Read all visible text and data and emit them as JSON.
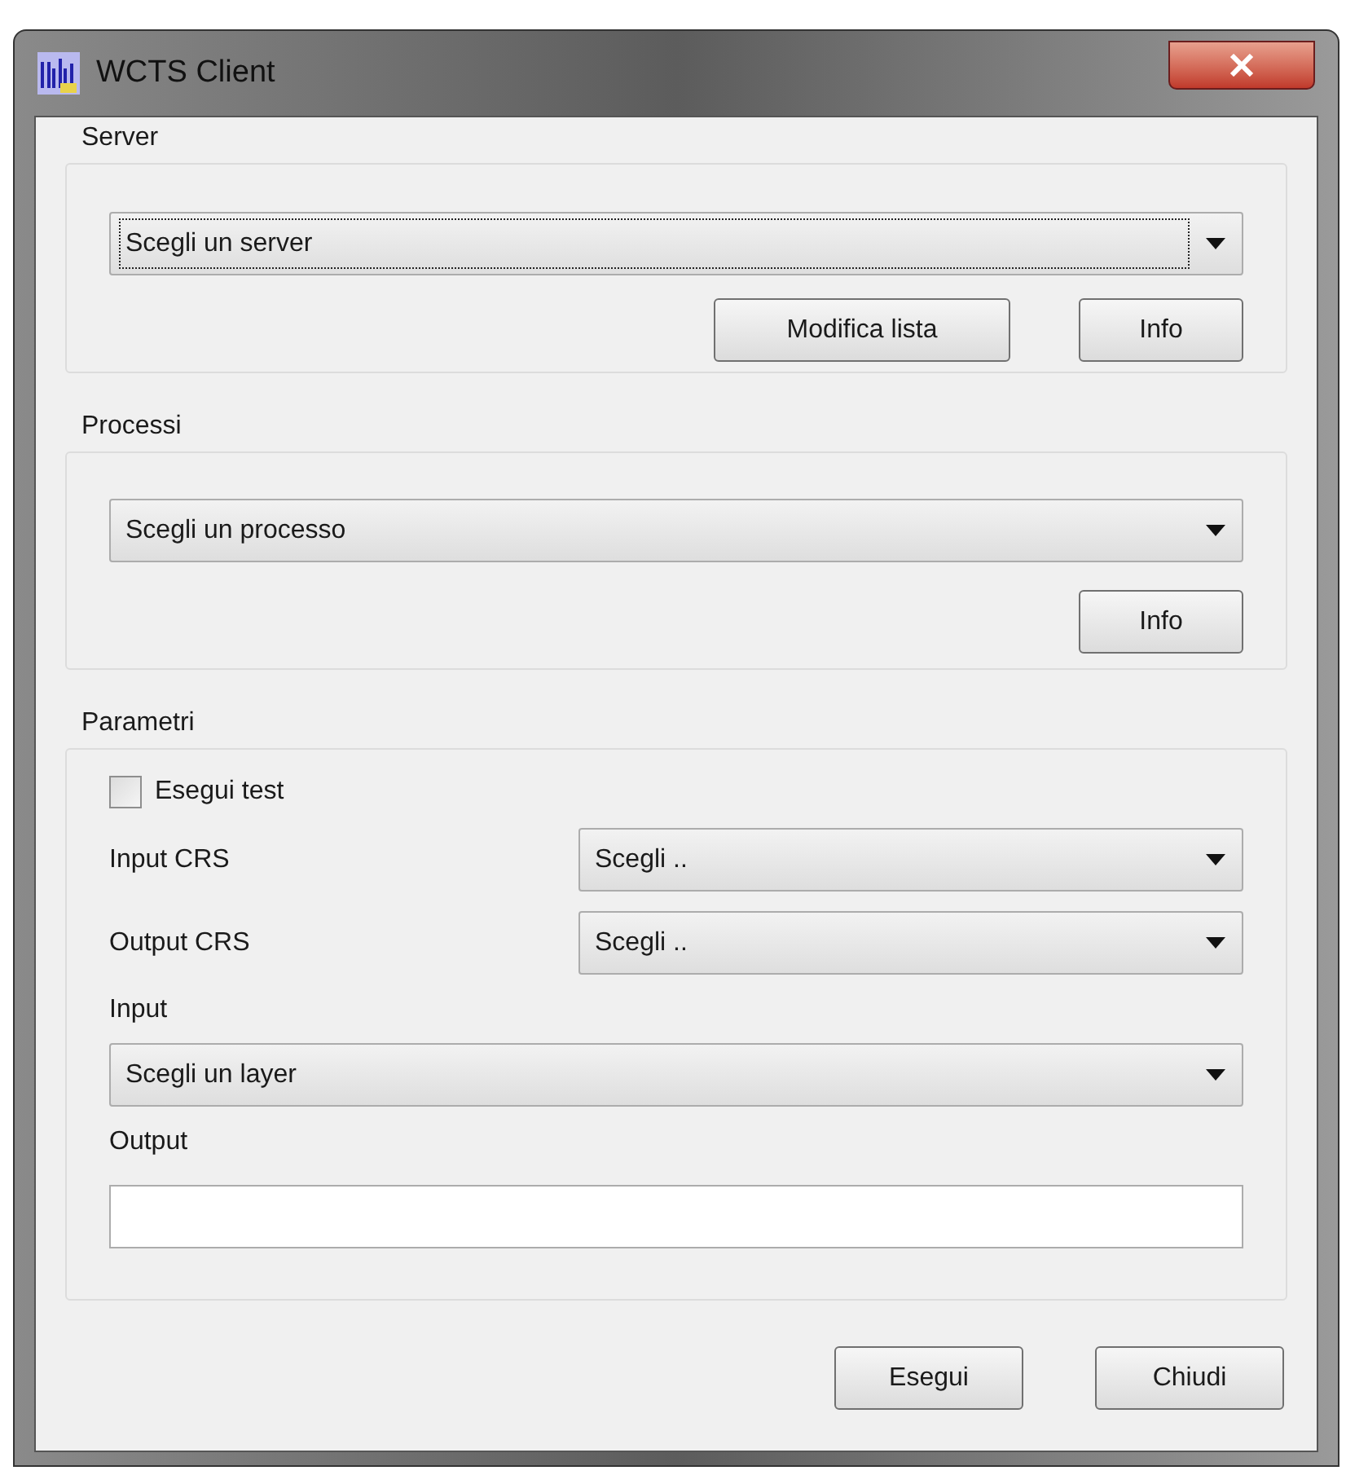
{
  "window": {
    "title": "WCTS Client"
  },
  "server": {
    "title": "Server",
    "combo": {
      "value": "Scegli un server",
      "focused": true
    },
    "buttons": [
      "Modifica lista",
      "Info"
    ]
  },
  "processi": {
    "title": "Processi",
    "combo": {
      "value": "Scegli un processo",
      "focused": false
    },
    "buttons": [
      "Info"
    ]
  },
  "parametri": {
    "title": "Parametri",
    "test": {
      "label": "Esegui test",
      "checked": false
    },
    "input_crs": {
      "label": "Input CRS",
      "value": "Scegli .."
    },
    "output_crs": {
      "label": "Output CRS",
      "value": "Scegli .."
    },
    "input": {
      "label": "Input",
      "value": "Scegli un layer"
    },
    "output": {
      "label": "Output"
    }
  },
  "buttons": [
    "Esegui",
    "Chiudi"
  ]
}
